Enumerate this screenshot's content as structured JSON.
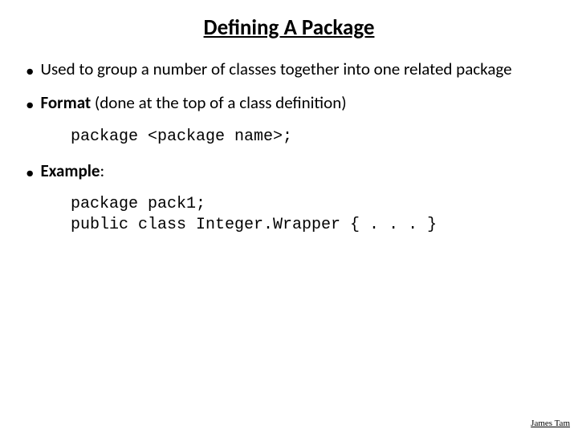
{
  "title": "Defining A Package",
  "bullets": {
    "b1_text": "Used to group a number of classes together into one related package",
    "b2_bold": "Format",
    "b2_rest": " (done at the top of a class definition)",
    "b3_bold": "Example",
    "b3_rest": ":"
  },
  "code": {
    "format_line": "package <package name>;",
    "example_line1": "package pack1;",
    "example_line2": "public class Integer.Wrapper { . . . }"
  },
  "footer": "James Tam"
}
